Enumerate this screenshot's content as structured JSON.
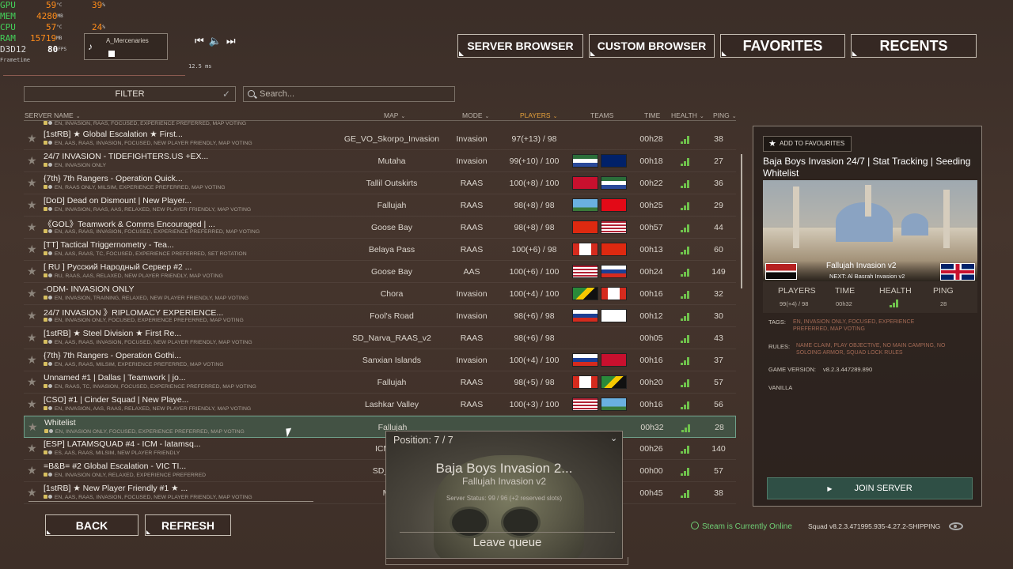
{
  "perf": {
    "gpu": {
      "label": "GPU",
      "v1": "59",
      "u1": "°C",
      "v2": "39",
      "u2": "%"
    },
    "mem": {
      "label": "MEM",
      "v1": "4280",
      "u1": "MB"
    },
    "cpu": {
      "label": "CPU",
      "v1": "57",
      "u1": "°C",
      "v2": "24",
      "u2": "%"
    },
    "ram": {
      "label": "RAM",
      "v1": "15719",
      "u1": "MB"
    },
    "d3d": {
      "label": "D3D12",
      "v1": "80",
      "u1": "FPS"
    },
    "frametime_label": "Frametime",
    "frametime_value": "12.5 ms"
  },
  "music": {
    "track": "A_Mercenaries",
    "controls": "⏮ ◀) ⏭"
  },
  "nav": {
    "server_browser": "SERVER BROWSER",
    "custom_browser": "CUSTOM BROWSER",
    "favorites": "FAVORITES",
    "recents": "RECENTS"
  },
  "filter": {
    "label": "FILTER",
    "check": "✓"
  },
  "search": {
    "placeholder": "Search..."
  },
  "columns": {
    "server_name": "SERVER NAME",
    "map": "MAP",
    "mode": "MODE",
    "players": "PLAYERS",
    "teams": "TEAMS",
    "time": "TIME",
    "health": "HEALTH",
    "ping": "PING"
  },
  "partial_row_tags": "EN, INVASION, RAAS, FOCUSED, EXPERIENCE PREFERRED, MAP VOTING",
  "servers": [
    {
      "name": "[1stRB] ★ Global Escalation ★ First...",
      "tags": "EN, AAS, RAAS, INVASION, FOCUSED, NEW PLAYER FRIENDLY, MAP VOTING",
      "map": "GE_VO_Skorpo_Invasion",
      "mode": "Invasion",
      "players": "97(+13) / 98",
      "time": "00h28",
      "ping": "38",
      "flags": [],
      "health": 3
    },
    {
      "name": "24/7 INVASION - TIDEFIGHTERS.US +EX...",
      "tags": "EN, INVASION ONLY",
      "map": "Mutaha",
      "mode": "Invasion",
      "players": "99(+10) / 100",
      "time": "00h18",
      "ping": "27",
      "flags": [
        "ins",
        "aus"
      ],
      "health": 3
    },
    {
      "name": "{7th} 7th Rangers - Operation Quick...",
      "tags": "EN, RAAS ONLY, MILSIM, EXPERIENCE PREFERRED, MAP VOTING",
      "map": "Tallil Outskirts",
      "mode": "RAAS",
      "players": "100(+8) / 100",
      "time": "00h22",
      "ping": "36",
      "flags": [
        "vdv",
        "ins"
      ],
      "health": 3
    },
    {
      "name": "[DoD] Dead on Dismount | New Player...",
      "tags": "EN, INVASION, RAAS, AAS, RELAXED, NEW PLAYER FRIENDLY, MAP VOTING",
      "map": "Fallujah",
      "mode": "RAAS",
      "players": "98(+8) / 98",
      "time": "00h25",
      "ping": "29",
      "flags": [
        "para",
        "tur"
      ],
      "health": 3
    },
    {
      "name": "《GOL》Teamwork & Comms Encouraged | ...",
      "tags": "EN, AAS, RAAS, INVASION, FOCUSED, EXPERIENCE PREFERRED, MAP VOTING",
      "map": "Goose Bay",
      "mode": "RAAS",
      "players": "98(+8) / 98",
      "time": "00h57",
      "ping": "44",
      "flags": [
        "chn",
        "usa"
      ],
      "health": 3
    },
    {
      "name": "[TT] Tactical Triggernometry - Tea...",
      "tags": "EN, AAS, RAAS, TC, FOCUSED, EXPERIENCE PREFERRED, SET ROTATION",
      "map": "Belaya Pass",
      "mode": "RAAS",
      "players": "100(+6) / 98",
      "time": "00h13",
      "ping": "60",
      "flags": [
        "can",
        "chn"
      ],
      "health": 3
    },
    {
      "name": "[ RU ] Русский Народный Сервер #2 ...",
      "tags": "RU, RAAS, AAS, RELAXED, NEW PLAYER FRIENDLY, MAP VOTING",
      "map": "Goose Bay",
      "mode": "AAS",
      "players": "100(+6) / 100",
      "time": "00h24",
      "ping": "149",
      "flags": [
        "usa",
        "rus"
      ],
      "health": 3
    },
    {
      "name": "-ODM- INVASION ONLY",
      "tags": "EN, INVASION, TRAINING, RELAXED, NEW PLAYER FRIENDLY, MAP VOTING",
      "map": "Chora",
      "mode": "Invasion",
      "players": "100(+4) / 100",
      "time": "00h16",
      "ping": "32",
      "flags": [
        "mil",
        "can"
      ],
      "health": 3
    },
    {
      "name": "24/7 INVASION 》RIPLOMACY EXPERIENCE...",
      "tags": "EN, INVASION ONLY, FOCUSED, EXPERIENCE PREFERRED, MAP VOTING",
      "map": "Fool's Road",
      "mode": "Invasion",
      "players": "98(+6) / 98",
      "time": "00h12",
      "ping": "30",
      "flags": [
        "rus",
        "irg"
      ],
      "health": 3
    },
    {
      "name": "[1stRB] ★ Steel Division ★ First Re...",
      "tags": "EN, AAS, RAAS, INVASION, FOCUSED, NEW PLAYER FRIENDLY, MAP VOTING",
      "map": "SD_Narva_RAAS_v2",
      "mode": "RAAS",
      "players": "98(+6) / 98",
      "time": "00h05",
      "ping": "43",
      "flags": [],
      "health": 3
    },
    {
      "name": "{7th} 7th Rangers - Operation Gothi...",
      "tags": "EN, AAS, RAAS, MILSIM, EXPERIENCE PREFERRED, MAP VOTING",
      "map": "Sanxian Islands",
      "mode": "Invasion",
      "players": "100(+4) / 100",
      "time": "00h16",
      "ping": "37",
      "flags": [
        "rus",
        "vdv"
      ],
      "health": 3
    },
    {
      "name": "Unnamed #1 | Dallas | Teamwork | jo...",
      "tags": "EN, RAAS, TC, INVASION, FOCUSED, EXPERIENCE PREFERRED, MAP VOTING",
      "map": "Fallujah",
      "mode": "RAAS",
      "players": "98(+5) / 98",
      "time": "00h20",
      "ping": "57",
      "flags": [
        "can",
        "mil"
      ],
      "health": 3
    },
    {
      "name": "[CSO] #1 | Cinder Squad | New Playe...",
      "tags": "EN, INVASION, AAS, RAAS, RELAXED, NEW PLAYER FRIENDLY, MAP VOTING",
      "map": "Lashkar Valley",
      "mode": "RAAS",
      "players": "100(+3) / 100",
      "time": "00h16",
      "ping": "56",
      "flags": [
        "usa",
        "para"
      ],
      "health": 3
    },
    {
      "name": "Whitelist",
      "tags": "EN, INVASION ONLY, FOCUSED, EXPERIENCE PREFERRED, MAP VOTING",
      "map": "Fallujah",
      "mode": "",
      "players": "",
      "time": "00h32",
      "ping": "28",
      "flags": [],
      "health": 3,
      "selected": true
    },
    {
      "name": "[ESP] LATAMSQUAD #4 - ICM - latamsq...",
      "tags": "ES, AAS, RAAS, MILSIM, NEW PLAYER FRIENDLY",
      "map": "ICM_Nar",
      "mode": "",
      "players": "",
      "time": "00h26",
      "ping": "140",
      "flags": [],
      "health": 3
    },
    {
      "name": "=B&B= #2 Global Escalation - VIC TI...",
      "tags": "EN, INVASION ONLY, RELAXED, EXPERIENCE PREFERRED",
      "map": "SD_Manic",
      "mode": "",
      "players": "",
      "time": "00h00",
      "ping": "57",
      "flags": [],
      "health": 3
    },
    {
      "name": "[1stRB] ★ New Player Friendly #1 ★ ...",
      "tags": "EN, AAS, RAAS, INVASION, FOCUSED, NEW PLAYER FRIENDLY, MAP VOTING",
      "map": "Mani",
      "mode": "",
      "players": "",
      "time": "00h45",
      "ping": "38",
      "flags": [],
      "health": 3
    }
  ],
  "buttons": {
    "back": "BACK",
    "refresh": "REFRESH"
  },
  "status": {
    "online": "Steam is Currently Online",
    "version": "Squad v8.2.3.471995.935-4.27.2-SHIPPING"
  },
  "details": {
    "add_favourite": "ADD TO FAVOURITES",
    "title": "Baja Boys Invasion 24/7 | Stat Tracking | Seeding Whitelist",
    "map": "Fallujah Invasion v2",
    "next": "NEXT: Al Basrah Invasion v2",
    "stats_headers": [
      "PLAYERS",
      "TIME",
      "HEALTH",
      "PING"
    ],
    "players": "99(+4) / 98",
    "time": "00h32",
    "health": 3,
    "ping": "28",
    "tags_label": "TAGS:",
    "tags": "EN, INVASION ONLY, FOCUSED, EXPERIENCE PREFERRED, MAP VOTING",
    "rules_label": "RULES:",
    "rules": "NAME CLAIM, PLAY OBJECTIVE, NO MAIN CAMPING, NO SOLOING ARMOR, SQUAD LOCK RULES",
    "game_version_label": "GAME VERSION:",
    "game_version": "v8.2.3.447289.890",
    "vanilla": "VANILLA",
    "join": "JOIN SERVER"
  },
  "queue": {
    "position": "Position: 7 / 7",
    "server": "Baja Boys Invasion 2...",
    "map": "Fallujah Invasion v2",
    "status": "Server Status: 99 / 96 (+2 reserved slots)",
    "leave": "Leave queue"
  },
  "colors": {
    "health": "#6fc14c",
    "join": "#2f4f45",
    "players_header": "#e6a13a"
  }
}
